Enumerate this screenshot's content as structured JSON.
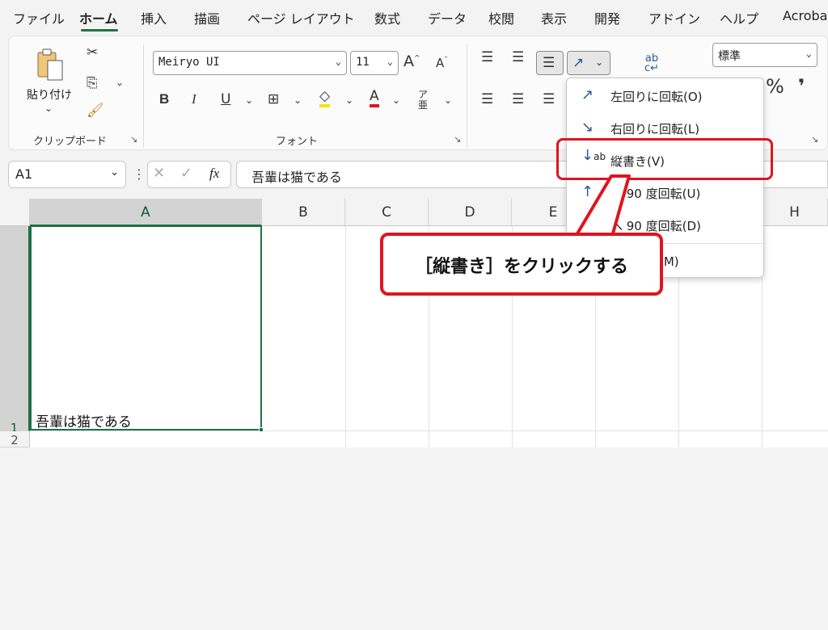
{
  "tabs": [
    "ファイル",
    "ホーム",
    "挿入",
    "描画",
    "ページ レイアウト",
    "数式",
    "データ",
    "校閲",
    "表示",
    "開発",
    "アドイン",
    "ヘルプ",
    "Acroba"
  ],
  "ribbon": {
    "clipboard_group": "クリップボード",
    "paste_label": "貼り付け",
    "font_group": "フォント",
    "font_name": "Meiryo UI",
    "font_size": "11",
    "number_format": "標準",
    "bold": "B",
    "italic": "I",
    "underline": "U",
    "percent": "%",
    "comma": "❜"
  },
  "formula_bar": {
    "cell_ref": "A1",
    "formula": "吾輩は猫である",
    "fx": "fx"
  },
  "grid": {
    "columns": [
      "A",
      "B",
      "C",
      "D",
      "E",
      "H"
    ],
    "rows": [
      "1",
      "2"
    ],
    "a1_value": "吾輩は猫である"
  },
  "menu": {
    "items": [
      "左回りに回転(O)",
      "右回りに回転(L)",
      "縦書き(V)",
      "へ 90 度回転(U)",
      "へ 90 度回転(D)",
      "置の設定(M)"
    ]
  },
  "callout": "［縦書き］をクリックする",
  "colors": {
    "accent": "#1e7145",
    "highlight": "#e0141e"
  }
}
